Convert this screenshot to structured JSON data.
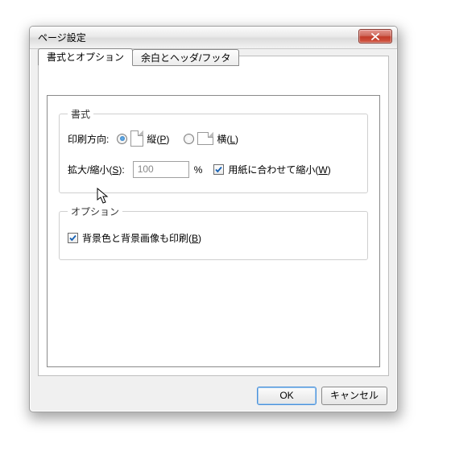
{
  "title": "ページ設定",
  "tabs": {
    "format": "書式とオプション",
    "margins": "余白とヘッダ/フッタ"
  },
  "format_section": {
    "legend": "書式",
    "orientation_label": "印刷方向:",
    "portrait_prefix": "縦(",
    "portrait_key": "P",
    "portrait_suffix": ")",
    "landscape_prefix": "横(",
    "landscape_key": "L",
    "landscape_suffix": ")",
    "scale_label_prefix": "拡大/縮小(",
    "scale_key": "S",
    "scale_label_suffix": "):",
    "scale_value": "100",
    "percent": "%",
    "fit_prefix": "用紙に合わせて縮小(",
    "fit_key": "W",
    "fit_suffix": ")"
  },
  "options_section": {
    "legend": "オプション",
    "print_bg_prefix": "背景色と背景画像も印刷(",
    "print_bg_key": "B",
    "print_bg_suffix": ")"
  },
  "buttons": {
    "ok": "OK",
    "cancel": "キャンセル"
  }
}
